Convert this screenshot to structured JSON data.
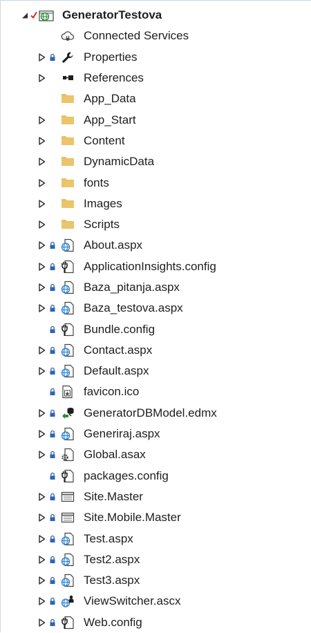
{
  "colors": {
    "folder": "#e8bf63",
    "lock": "#2f63b6",
    "globe": "#2a7ec2",
    "text": "#1e1e1e",
    "check": "#d42b2b",
    "arrow": "#333333"
  },
  "project": {
    "label": "GeneratorTestova",
    "icon": "web-project-icon"
  },
  "items": [
    {
      "label": "Connected Services",
      "icon": "connected-services-icon",
      "expandable": false,
      "lock": false
    },
    {
      "label": "Properties",
      "icon": "wrench-icon",
      "expandable": true,
      "lock": true
    },
    {
      "label": "References",
      "icon": "references-icon",
      "expandable": true,
      "lock": false
    },
    {
      "label": "App_Data",
      "icon": "folder-icon",
      "expandable": false,
      "lock": false
    },
    {
      "label": "App_Start",
      "icon": "folder-icon",
      "expandable": true,
      "lock": false
    },
    {
      "label": "Content",
      "icon": "folder-icon",
      "expandable": true,
      "lock": false
    },
    {
      "label": "DynamicData",
      "icon": "folder-icon",
      "expandable": true,
      "lock": false
    },
    {
      "label": "fonts",
      "icon": "folder-icon",
      "expandable": true,
      "lock": false
    },
    {
      "label": "Images",
      "icon": "folder-icon",
      "expandable": true,
      "lock": false
    },
    {
      "label": "Scripts",
      "icon": "folder-icon",
      "expandable": true,
      "lock": false
    },
    {
      "label": "About.aspx",
      "icon": "aspx-page-icon",
      "expandable": true,
      "lock": true
    },
    {
      "label": "ApplicationInsights.config",
      "icon": "config-file-icon",
      "expandable": true,
      "lock": true
    },
    {
      "label": "Baza_pitanja.aspx",
      "icon": "aspx-page-icon",
      "expandable": true,
      "lock": true
    },
    {
      "label": "Baza_testova.aspx",
      "icon": "aspx-page-icon",
      "expandable": true,
      "lock": true
    },
    {
      "label": "Bundle.config",
      "icon": "config-file-icon",
      "expandable": false,
      "lock": true
    },
    {
      "label": "Contact.aspx",
      "icon": "aspx-page-icon",
      "expandable": true,
      "lock": true
    },
    {
      "label": "Default.aspx",
      "icon": "aspx-page-icon",
      "expandable": true,
      "lock": true
    },
    {
      "label": "favicon.ico",
      "icon": "ico-file-icon",
      "expandable": false,
      "lock": true
    },
    {
      "label": "GeneratorDBModel.edmx",
      "icon": "edmx-model-icon",
      "expandable": true,
      "lock": true
    },
    {
      "label": "Generiraj.aspx",
      "icon": "aspx-page-icon",
      "expandable": true,
      "lock": true
    },
    {
      "label": "Global.asax",
      "icon": "asax-file-icon",
      "expandable": true,
      "lock": true
    },
    {
      "label": "packages.config",
      "icon": "config-file-icon",
      "expandable": false,
      "lock": true
    },
    {
      "label": "Site.Master",
      "icon": "master-page-icon",
      "expandable": true,
      "lock": true
    },
    {
      "label": "Site.Mobile.Master",
      "icon": "master-page-icon",
      "expandable": true,
      "lock": true
    },
    {
      "label": "Test.aspx",
      "icon": "aspx-page-icon",
      "expandable": true,
      "lock": true
    },
    {
      "label": "Test2.aspx",
      "icon": "aspx-page-icon",
      "expandable": true,
      "lock": true
    },
    {
      "label": "Test3.aspx",
      "icon": "aspx-page-icon",
      "expandable": true,
      "lock": true
    },
    {
      "label": "ViewSwitcher.ascx",
      "icon": "user-control-icon",
      "expandable": true,
      "lock": true
    },
    {
      "label": "Web.config",
      "icon": "config-file-icon",
      "expandable": true,
      "lock": true
    }
  ]
}
